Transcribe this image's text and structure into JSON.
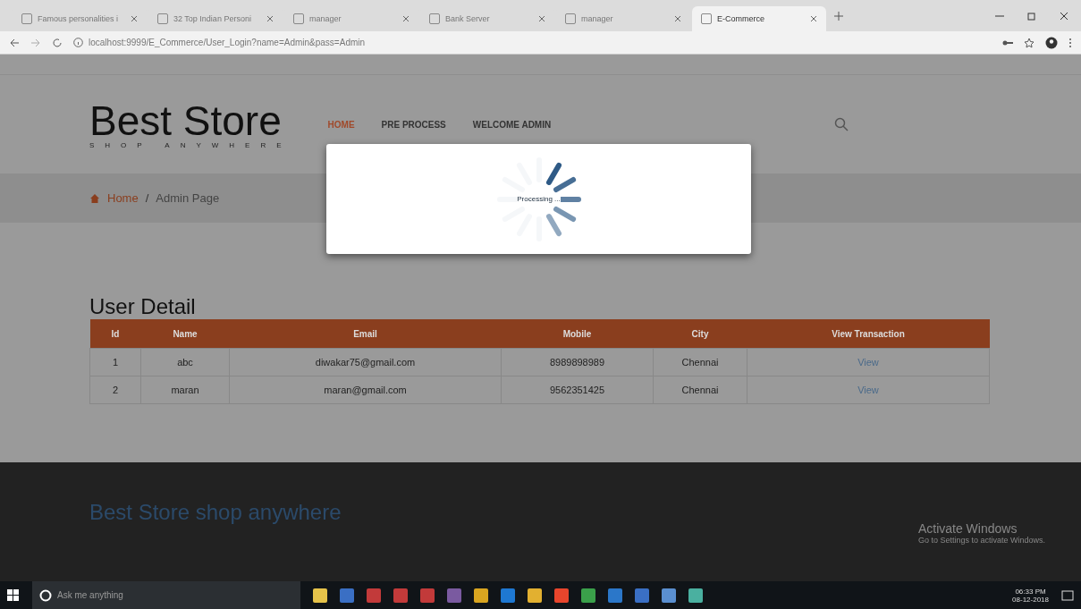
{
  "browser": {
    "tabs": [
      {
        "title": "Famous personalities i",
        "selected": false
      },
      {
        "title": "32 Top Indian Personi",
        "selected": false
      },
      {
        "title": "manager",
        "selected": false
      },
      {
        "title": "Bank Server",
        "selected": false
      },
      {
        "title": "manager",
        "selected": false
      },
      {
        "title": "E-Commerce",
        "selected": true
      }
    ],
    "address": "localhost:9999/E_Commerce/User_Login?name=Admin&pass=Admin"
  },
  "header": {
    "logo": "Best Store",
    "tagline": "SHOP ANYWHERE",
    "nav": [
      {
        "label": "HOME",
        "selected": true
      },
      {
        "label": "PRE PROCESS",
        "selected": false
      },
      {
        "label": "WELCOME ADMIN",
        "selected": false
      }
    ]
  },
  "breadcrumb": {
    "home": "Home",
    "separator": "/",
    "current": "Admin Page"
  },
  "modal": {
    "message": "Processing ..."
  },
  "table": {
    "title": "User Detail",
    "columns": [
      "Id",
      "Name",
      "Email",
      "Mobile",
      "City",
      "View Transaction"
    ],
    "rows": [
      [
        "1",
        "abc",
        "diwakar75@gmail.com",
        "8989898989",
        "Chennai",
        "View"
      ],
      [
        "2",
        "maran",
        "maran@gmail.com",
        "9562351425",
        "Chennai",
        "View"
      ]
    ]
  },
  "footer": {
    "title": "Best Store shop anywhere"
  },
  "activation": {
    "title": "Activate Windows",
    "hint": "Go to Settings to activate Windows."
  },
  "taskbar": {
    "search_placeholder": "Ask me anything",
    "time": "06:33 PM",
    "date": "08-12-2018"
  }
}
